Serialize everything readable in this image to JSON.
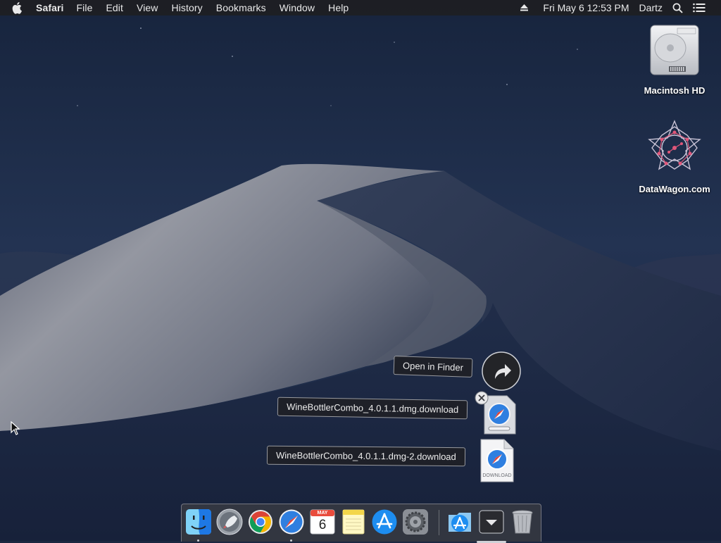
{
  "menubar": {
    "app_name": "Safari",
    "menus": [
      "File",
      "Edit",
      "View",
      "History",
      "Bookmarks",
      "Window",
      "Help"
    ],
    "datetime": "Fri May 6  12:53 PM",
    "user": "Dartz",
    "icons": [
      "apple-logo-icon",
      "eject-icon",
      "spotlight-search-icon",
      "notification-center-icon"
    ]
  },
  "desktop": {
    "icons": [
      {
        "label": "Macintosh HD",
        "icon": "hard-drive-icon"
      },
      {
        "label": "DataWagon.com",
        "icon": "datawagon-logo-icon"
      }
    ]
  },
  "stack": {
    "open_in_finder": "Open in Finder",
    "files": [
      {
        "name": "WineBottlerCombo_4.0.1.1.dmg.download",
        "icon": "safari-download-icon"
      },
      {
        "name": "WineBottlerCombo_4.0.1.1.dmg-2.download",
        "icon": "download-document-icon",
        "badge": "DOWNLOAD"
      }
    ]
  },
  "calendar": {
    "month": "MAY",
    "day": "6"
  },
  "dock": {
    "apps": [
      "Finder",
      "Launchpad",
      "Google Chrome",
      "Safari",
      "Calendar",
      "Notes",
      "App Store",
      "System Preferences",
      "Applications",
      "Downloads",
      "Trash"
    ]
  },
  "colors": {
    "menubar_bg": "#1e1e22",
    "sky": "#1b2740",
    "dune_light": "#8d8f98",
    "safari_blue": "#2f7fe0",
    "label_bg": "#1e2026"
  }
}
